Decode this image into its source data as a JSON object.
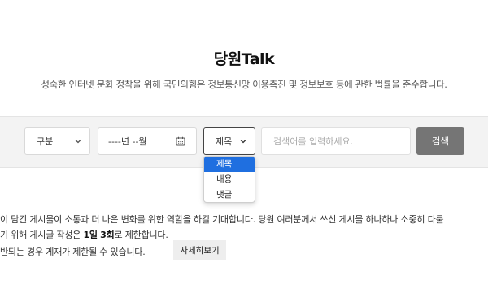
{
  "header": {
    "title": "당원Talk",
    "subtitle": "성숙한 인터넷 문화 정착을 위해 국민의힘은 정보통신망 이용촉진 및 정보보호 등에 관한 법률을 준수합니다."
  },
  "search": {
    "category_label": "구분",
    "date_value": "----년 --월",
    "field_label": "제목",
    "placeholder": "검색어를 입력하세요.",
    "button_label": "검색",
    "field_options": [
      "제목",
      "내용",
      "댓글"
    ],
    "selected_option": "제목"
  },
  "notice": {
    "line1": "이 담긴 게시물이 소통과 더 나은 변화를 위한 역할을 하길 기대합니다. 당원 여러분께서 쓰신 게시물 하나하나 소중히 다룰",
    "line2_pre": "기 위해 게시글 작성은 ",
    "line2_bold1": "1일",
    "line2_sp": " ",
    "line2_bold2": "3회",
    "line2_post": "로 제한합니다.",
    "line3": "반되는 경우 게재가 제한될 수 있습니다.",
    "detail_button": "자세히보기"
  },
  "colors": {
    "selected_option_bg": "#1f6fe0",
    "search_button_bg": "#757575",
    "search_band_bg": "#f3f3f3"
  },
  "icons": {
    "category_select": "chevron-down-icon",
    "field_select": "chevron-down-icon",
    "date_input": "calendar-icon"
  }
}
